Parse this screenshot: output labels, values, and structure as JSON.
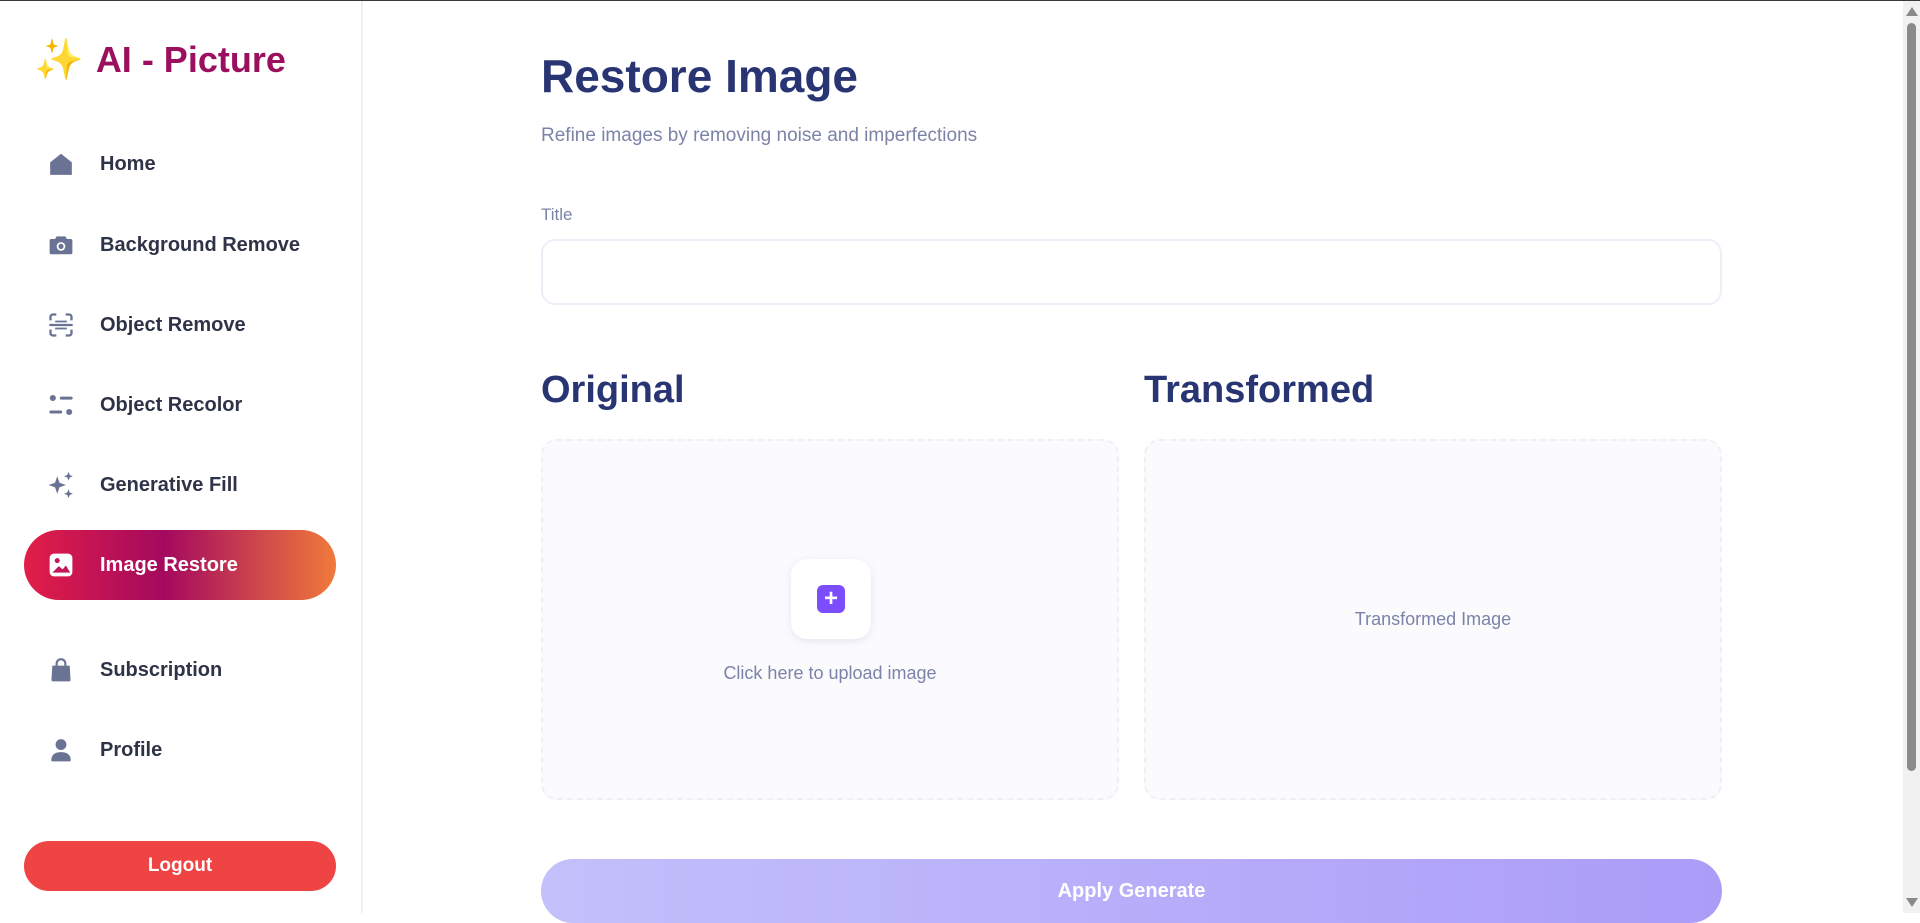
{
  "app": {
    "logo_text": "AI - Picture",
    "logo_icon": "sparkles-icon"
  },
  "sidebar": {
    "items": [
      {
        "label": "Home",
        "icon": "home-icon",
        "active": false
      },
      {
        "label": "Background Remove",
        "icon": "camera-icon",
        "active": false
      },
      {
        "label": "Object Remove",
        "icon": "scan-icon",
        "active": false
      },
      {
        "label": "Object Recolor",
        "icon": "filter-icon",
        "active": false
      },
      {
        "label": "Generative Fill",
        "icon": "stars-icon",
        "active": false
      },
      {
        "label": "Image Restore",
        "icon": "image-icon",
        "active": true
      },
      {
        "label": "Subscription",
        "icon": "bag-icon",
        "active": false
      },
      {
        "label": "Profile",
        "icon": "user-icon",
        "active": false
      }
    ],
    "logout_label": "Logout"
  },
  "main": {
    "title": "Restore Image",
    "subtitle": "Refine images by removing noise and imperfections",
    "form": {
      "title_label": "Title",
      "title_value": "",
      "title_placeholder": ""
    },
    "original": {
      "heading": "Original",
      "upload_text": "Click here to upload image"
    },
    "transformed": {
      "heading": "Transformed",
      "placeholder_text": "Transformed Image"
    },
    "apply_label": "Apply Generate"
  },
  "colors": {
    "brand": "#9b0f5f",
    "heading": "#293573",
    "muted": "#7b83a8",
    "icon": "#6b7394",
    "active_gradient": [
      "#e21e48",
      "#a4095f",
      "#f07a3b"
    ],
    "logout": "#ef4444",
    "upload_accent": "#7c4dff",
    "apply_gradient": [
      "#c3c0fb",
      "#ab9cf8"
    ]
  }
}
